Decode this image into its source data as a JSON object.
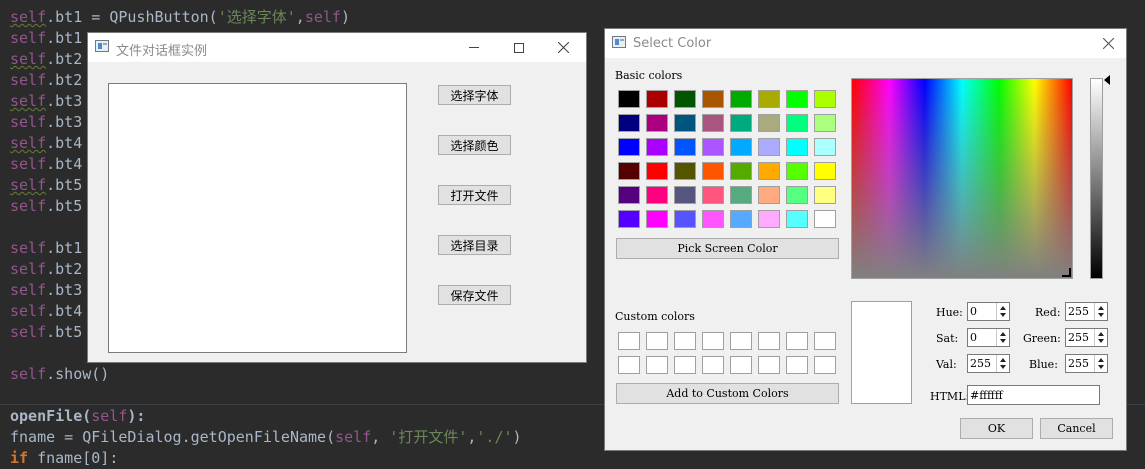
{
  "editor": {
    "lines": [
      {
        "self": "self",
        "rest": ".bt1 = QPushButton(",
        "str": "'选择字体'",
        "tail": ",",
        "self2": "self",
        "end": ")"
      },
      {
        "self": "self",
        "rest": ".bt1"
      },
      {
        "self": "self",
        "rest": ".bt2"
      },
      {
        "self": "self",
        "rest": ".bt2"
      },
      {
        "self": "self",
        "rest": ".bt3"
      },
      {
        "self": "self",
        "rest": ".bt3"
      },
      {
        "self": "self",
        "rest": ".bt4"
      },
      {
        "self": "self",
        "rest": ".bt4"
      },
      {
        "self": "self",
        "rest": ".bt5"
      },
      {
        "self": "self",
        "rest": ".bt5"
      },
      {
        "self": "self",
        "rest": ".bt1"
      },
      {
        "self": "self",
        "rest": ".bt2"
      },
      {
        "self": "self",
        "rest": ".bt3"
      },
      {
        "self": "self",
        "rest": ".bt4"
      },
      {
        "self": "self",
        "rest": ".bt5"
      },
      {
        "self": "self",
        "rest": ".show()"
      }
    ],
    "def_line": {
      "name": "openFile",
      "open": "(",
      "param": "self",
      "close": "):"
    },
    "fname_line": {
      "pre": "fname = QFileDialog.getOpenFileName(",
      "self": "self",
      "mid": ", ",
      "str1": "'打开文件'",
      "comma": ",",
      "str2": "'./'",
      "end": ")"
    },
    "if_line": {
      "kw": "if",
      "rest": " fname[0]:"
    }
  },
  "demo_window": {
    "title": "文件对话框实例",
    "buttons": [
      "选择字体",
      "选择颜色",
      "打开文件",
      "选择目录",
      "保存文件"
    ]
  },
  "color_dialog": {
    "title": "Select Color",
    "basic_colors_label": "Basic colors",
    "custom_colors_label": "Custom colors",
    "pick_screen_label": "Pick Screen Color",
    "add_custom_label": "Add to Custom Colors",
    "basic_colors": [
      [
        "#000000",
        "#aa0000",
        "#005500",
        "#aa5500",
        "#00aa00",
        "#aaaa00",
        "#00ff00",
        "#aaff00"
      ],
      [
        "#00007f",
        "#aa007f",
        "#00557f",
        "#aa557f",
        "#00aa7f",
        "#aaaa7f",
        "#00ff7f",
        "#aaff7f"
      ],
      [
        "#0000ff",
        "#aa00ff",
        "#0055ff",
        "#aa55ff",
        "#00aaff",
        "#aaaaff",
        "#00ffff",
        "#aaffff"
      ],
      [
        "#550000",
        "#ff0000",
        "#555500",
        "#ff5500",
        "#55aa00",
        "#ffaa00",
        "#55ff00",
        "#ffff00"
      ],
      [
        "#55007f",
        "#ff007f",
        "#55557f",
        "#ff557f",
        "#55aa7f",
        "#ffaa7f",
        "#55ff7f",
        "#ffff7f"
      ],
      [
        "#5500ff",
        "#ff00ff",
        "#5555ff",
        "#ff55ff",
        "#55aaff",
        "#ffaaff",
        "#55ffff",
        "#ffffff"
      ]
    ],
    "fields": {
      "hue_label": "Hue:",
      "hue": "0",
      "sat_label": "Sat:",
      "sat": "0",
      "val_label": "Val:",
      "val": "255",
      "red_label": "Red:",
      "red": "255",
      "green_label": "Green:",
      "green": "255",
      "blue_label": "Blue:",
      "blue": "255",
      "html_label": "HTML:",
      "html": "#ffffff"
    },
    "ok_label": "OK",
    "cancel_label": "Cancel",
    "current_color": "#ffffff"
  }
}
